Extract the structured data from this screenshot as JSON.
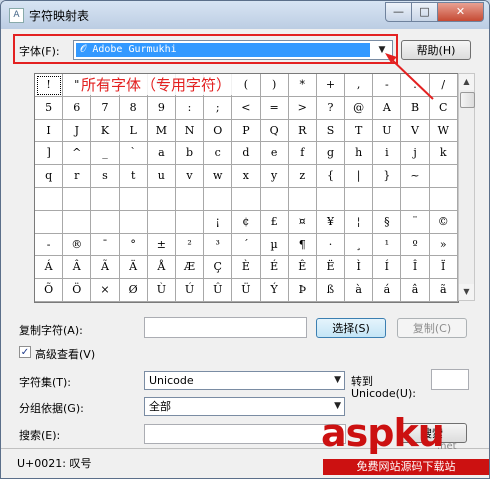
{
  "window": {
    "title": "字符映射表",
    "icon_glyph": "A",
    "controls": {
      "minimize": "—",
      "maximize": "□",
      "close": "✕"
    }
  },
  "font_row": {
    "label": "字体(F):",
    "selected_font": "𝒪 Adobe Gurmukhi",
    "help_button": "帮助(H)"
  },
  "annotation": {
    "text": "所有字体（专用字符）",
    "color": "#e32121"
  },
  "grid": {
    "rows": [
      [
        "!",
        "\"",
        "#",
        "$",
        "%",
        "&",
        "'",
        "(",
        ")",
        "*",
        "+",
        ",",
        "-",
        ".",
        "/"
      ],
      [
        "5",
        "6",
        "7",
        "8",
        "9",
        ":",
        ";",
        "<",
        "=",
        ">",
        "?",
        "@",
        "A",
        "B",
        "C"
      ],
      [
        "I",
        "J",
        "K",
        "L",
        "M",
        "N",
        "O",
        "P",
        "Q",
        "R",
        "S",
        "T",
        "U",
        "V",
        "W"
      ],
      [
        "]",
        "^",
        "_",
        "`",
        "a",
        "b",
        "c",
        "d",
        "e",
        "f",
        "g",
        "h",
        "i",
        "j",
        "k"
      ],
      [
        "q",
        "r",
        "s",
        "t",
        "u",
        "v",
        "w",
        "x",
        "y",
        "z",
        "{",
        "|",
        "}",
        "~",
        ""
      ],
      [
        "",
        "",
        "",
        "",
        "",
        "",
        "",
        "",
        "",
        "",
        "",
        "",
        "",
        "",
        ""
      ],
      [
        "",
        "",
        "",
        "",
        "",
        "",
        "¡",
        "¢",
        "£",
        "¤",
        "¥",
        "¦",
        "§",
        "¨",
        "©"
      ],
      [
        "-",
        "®",
        "¯",
        "°",
        "±",
        "²",
        "³",
        "´",
        "µ",
        "¶",
        "·",
        "¸",
        "¹",
        "º",
        "»"
      ],
      [
        "Á",
        "Â",
        "Ã",
        "Ä",
        "Å",
        "Æ",
        "Ç",
        "È",
        "É",
        "Ê",
        "Ë",
        "Ì",
        "Í",
        "Î",
        "Ï"
      ],
      [
        "Õ",
        "Ö",
        "×",
        "Ø",
        "Ù",
        "Ú",
        "Û",
        "Ü",
        "Ý",
        "Þ",
        "ß",
        "à",
        "á",
        "â",
        "ã"
      ]
    ]
  },
  "copy_row": {
    "label": "复制字符(A):",
    "value": "",
    "select_button": "选择(S)",
    "copy_button": "复制(C)"
  },
  "advanced": {
    "label": "高级查看(V)",
    "checked": true,
    "check_glyph": "✓"
  },
  "charset_row": {
    "label": "字符集(T):",
    "value": "Unicode",
    "goto_label": "转到",
    "goto_unicode_label": "Unicode(U):",
    "goto_value": ""
  },
  "groupby_row": {
    "label": "分组依据(G):",
    "value": "全部"
  },
  "search_row": {
    "label": "搜索(E):",
    "value": "",
    "button": "搜索"
  },
  "status": {
    "text": "U+0021: 叹号"
  },
  "watermark": {
    "main": "aspku",
    "sub": ".net",
    "bar": "免费网站源码下载站"
  }
}
